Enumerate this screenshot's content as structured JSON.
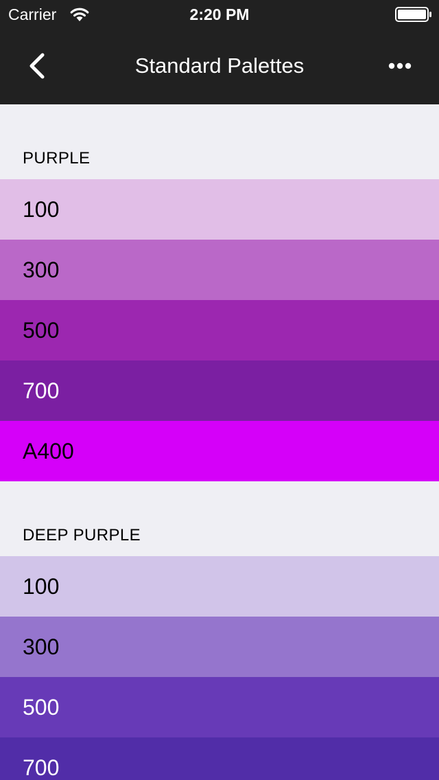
{
  "status_bar": {
    "carrier": "Carrier",
    "time": "2:20 PM",
    "wifi_icon": "wifi-icon",
    "battery_icon": "battery-icon"
  },
  "nav": {
    "title": "Standard Palettes",
    "back_icon": "chevron-left-icon",
    "more_icon": "more-horizontal-icon"
  },
  "colors": {
    "nav_background": "#212121",
    "page_background": "#efeff4"
  },
  "sections": [
    {
      "title": "PURPLE",
      "swatches": [
        {
          "label": "100",
          "color": "#e1bee7",
          "text_color": "#000000"
        },
        {
          "label": "300",
          "color": "#ba68c8",
          "text_color": "#000000"
        },
        {
          "label": "500",
          "color": "#9c27b0",
          "text_color": "#000000"
        },
        {
          "label": "700",
          "color": "#7b1fa2",
          "text_color": "#ffffff"
        },
        {
          "label": "A400",
          "color": "#d500f9",
          "text_color": "#000000"
        }
      ]
    },
    {
      "title": "DEEP PURPLE",
      "swatches": [
        {
          "label": "100",
          "color": "#d1c4e9",
          "text_color": "#000000"
        },
        {
          "label": "300",
          "color": "#9575cd",
          "text_color": "#000000"
        },
        {
          "label": "500",
          "color": "#673ab7",
          "text_color": "#ffffff"
        },
        {
          "label": "700",
          "color": "#512da8",
          "text_color": "#ffffff"
        }
      ]
    }
  ]
}
